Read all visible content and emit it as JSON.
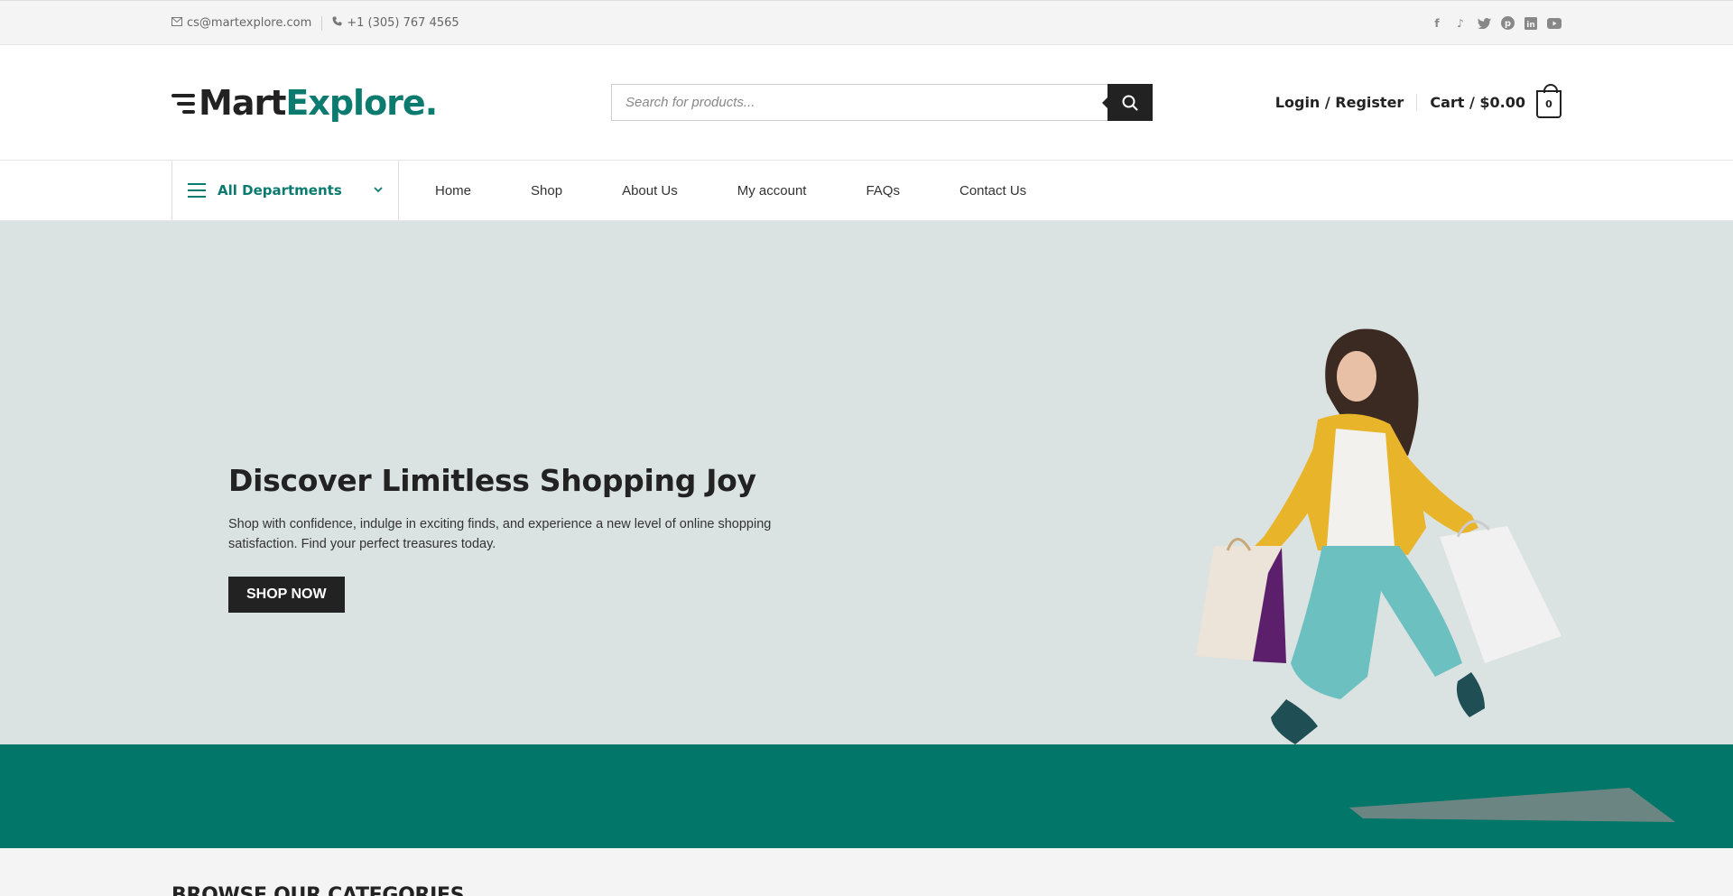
{
  "topbar": {
    "email": "cs@martexplore.com",
    "phone": "+1 (305) 767 4565",
    "social": [
      "facebook-icon",
      "tiktok-icon",
      "twitter-icon",
      "pinterest-icon",
      "linkedin-icon",
      "youtube-icon"
    ]
  },
  "header": {
    "logo_part1": "Mart",
    "logo_part2": "Explore.",
    "search_placeholder": "Search for products...",
    "login_label": "Login / Register",
    "cart_label": "Cart / $0.00",
    "cart_count": "0"
  },
  "nav": {
    "departments_label": "All Departments",
    "items": [
      "Home",
      "Shop",
      "About Us",
      "My account",
      "FAQs",
      "Contact Us"
    ]
  },
  "hero": {
    "title": "Discover Limitless Shopping Joy",
    "text": "Shop with confidence, indulge in exciting finds, and experience a new level of online shopping satisfaction. Find your perfect treasures today.",
    "button_label": "SHOP NOW"
  },
  "browse": {
    "heading": "BROWSE OUR CATEGORIES"
  },
  "colors": {
    "brand": "#0b7a6f",
    "hero_bg": "#dbe2e2",
    "hero_band": "#017669",
    "dark": "#222222"
  }
}
